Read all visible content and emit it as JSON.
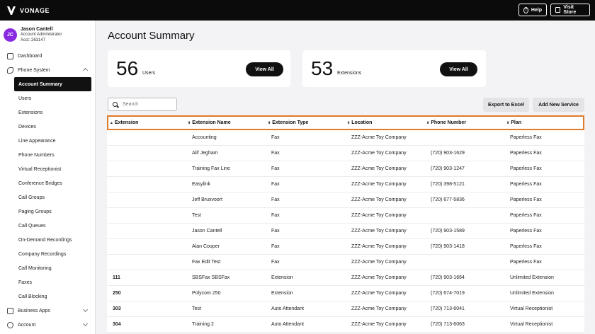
{
  "topbar": {
    "brand": "VONAGE",
    "help_label": "Help",
    "store_label": "Visit Store"
  },
  "user": {
    "initials": "JC",
    "name": "Jason Cantell",
    "role": "Account Administrator",
    "acct": "Acct: 263147"
  },
  "nav": {
    "dashboard": "Dashboard",
    "phone_system": "Phone System",
    "sub_items": [
      "Account Summary",
      "Users",
      "Extensions",
      "Devices",
      "Line Appearance",
      "Phone Numbers",
      "Virtual Receptionist",
      "Conference Bridges",
      "Call Groups",
      "Paging Groups",
      "Call Queues",
      "On-Demand Recordings",
      "Company Recordings",
      "Call Monitoring",
      "Faxes",
      "Call Blocking"
    ],
    "business_apps": "Business Apps",
    "account": "Account"
  },
  "page": {
    "title": "Account Summary"
  },
  "cards": {
    "users": {
      "count": "56",
      "label": "Users",
      "button": "View All"
    },
    "extensions": {
      "count": "53",
      "label": "Extensions",
      "button": "View All"
    }
  },
  "toolbar": {
    "search_placeholder": "Search",
    "export_label": "Export to Excel",
    "add_label": "Add New Service"
  },
  "table": {
    "headers": [
      "Extension",
      "Extension Name",
      "Extension Type",
      "Location",
      "Phone Number",
      "Plan"
    ],
    "rows": [
      [
        "",
        "Accounting",
        "Fax",
        "ZZZ-Acme Toy Company",
        "",
        "Paperless Fax"
      ],
      [
        "",
        "Alif Jegham",
        "Fax",
        "ZZZ-Acme Toy Company",
        "(720) 903-1629",
        "Paperless Fax"
      ],
      [
        "",
        "Training Fax Line",
        "Fax",
        "ZZZ-Acme Toy Company",
        "(720) 903-1247",
        "Paperless Fax"
      ],
      [
        "",
        "Easylink",
        "Fax",
        "ZZZ-Acme Toy Company",
        "(720) 398-5121",
        "Paperless Fax"
      ],
      [
        "",
        "Jeff Bruxvoort",
        "Fax",
        "ZZZ-Acme Toy Company",
        "(720) 677-5836",
        "Paperless Fax"
      ],
      [
        "",
        "Test",
        "Fax",
        "ZZZ-Acme Toy Company",
        "",
        "Paperless Fax"
      ],
      [
        "",
        "Jason Cantell",
        "Fax",
        "ZZZ-Acme Toy Company",
        "(720) 903-1589",
        "Paperless Fax"
      ],
      [
        "",
        "Alan Cooper",
        "Fax",
        "ZZZ-Acme Toy Company",
        "(720) 903-1418",
        "Paperless Fax"
      ],
      [
        "",
        "Fax Edit Test",
        "Fax",
        "ZZZ-Acme Toy Company",
        "",
        "Paperless Fax"
      ],
      [
        "111",
        "SBSFax SBSFax",
        "Extension",
        "ZZZ-Acme Toy Company",
        "(720) 903-1664",
        "Unlimited Extension"
      ],
      [
        "250",
        "Polycom 250",
        "Extension",
        "ZZZ-Acme Toy Company",
        "(720) 674-7019",
        "Unlimited Extension"
      ],
      [
        "303",
        "Test",
        "Auto Attendant",
        "ZZZ-Acme Toy Company",
        "(720) 713-6041",
        "Virtual Receptionist"
      ],
      [
        "304",
        "Training 2",
        "Auto Attendant",
        "ZZZ-Acme Toy Company",
        "(720) 713-6063",
        "Virtual Receptionist"
      ]
    ]
  }
}
